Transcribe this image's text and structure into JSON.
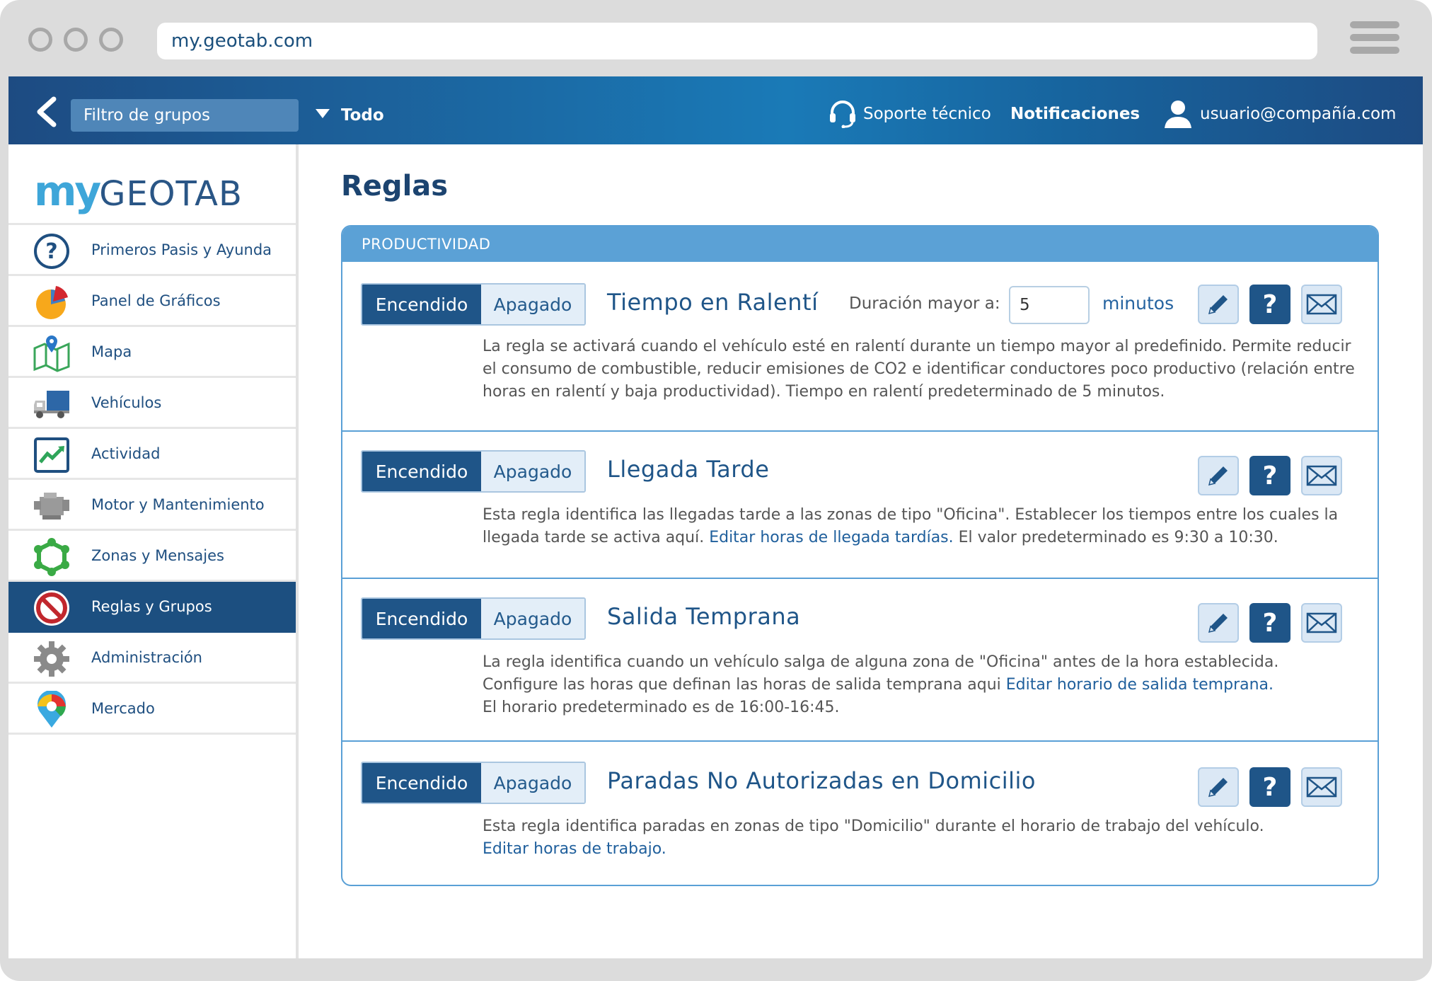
{
  "browser": {
    "url": "my.geotab.com"
  },
  "topbar": {
    "group_filter": "Filtro de grupos",
    "group_value": "Todo",
    "support": "Soporte técnico",
    "notifications": "Notificaciones",
    "user": "usuario@compañía.com"
  },
  "logo": {
    "my": "my",
    "geotab": "GEOTAB"
  },
  "sidebar": {
    "items": [
      {
        "label": "Primeros Pasis y Ayunda",
        "icon": "help-circle-icon"
      },
      {
        "label": "Panel de Gráficos",
        "icon": "pie-chart-icon"
      },
      {
        "label": "Mapa",
        "icon": "map-icon"
      },
      {
        "label": "Vehículos",
        "icon": "truck-icon"
      },
      {
        "label": "Actividad",
        "icon": "activity-chart-icon"
      },
      {
        "label": "Motor y Mantenimiento",
        "icon": "engine-icon"
      },
      {
        "label": "Zonas y Mensajes",
        "icon": "zone-icon"
      },
      {
        "label": "Reglas y Grupos",
        "icon": "prohibited-icon",
        "active": true
      },
      {
        "label": "Administración",
        "icon": "gear-icon"
      },
      {
        "label": "Mercado",
        "icon": "marketplace-pin-icon"
      }
    ]
  },
  "main": {
    "title": "Reglas",
    "section": "PRODUCTIVIDAD",
    "toggle_on": "Encendido",
    "toggle_off": "Apagado",
    "rules": [
      {
        "title": "Tiempo en Ralentí",
        "duration_label": "Duración mayor a:",
        "duration_value": "5",
        "duration_unit": "minutos",
        "desc": "La regla se activará cuando el vehículo esté en ralentí durante un tiempo mayor al predefinido. Permite reducir el consumo de combustible, reducir emisiones de CO2 e identificar conductores poco productivo (relación entre horas en ralentí y baja productividad). Tiempo en ralentí predeterminado de 5 minutos."
      },
      {
        "title": "Llegada Tarde",
        "desc_before": "Esta regla identifica las llegadas tarde a las zonas de tipo \"Oficina\". Establecer los tiempos entre los cuales la llegada tarde se activa aquí. ",
        "link": "Editar horas de llegada tardías.",
        "desc_after": " El valor predeterminado es 9:30 a 10:30."
      },
      {
        "title": "Salida Temprana",
        "line1": "La regla identifica cuando un vehículo salga de alguna zona de \"Oficina\" antes de la hora establecida.",
        "line2_before": "Configure las horas que definan las horas de salida temprana aqui ",
        "link": "Editar horario de salida temprana.",
        "line3": "El horario predeterminado es de 16:00-16:45."
      },
      {
        "title": "Paradas No Autorizadas en Domicilio",
        "line1": "Esta regla identifica paradas en zonas de tipo \"Domicilio\" durante el horario de trabajo del vehículo.",
        "link": "Editar horas de trabajo."
      }
    ]
  },
  "colors": {
    "primary": "#1f5588",
    "accent": "#5ba1d6",
    "link": "#1f5f9c"
  }
}
